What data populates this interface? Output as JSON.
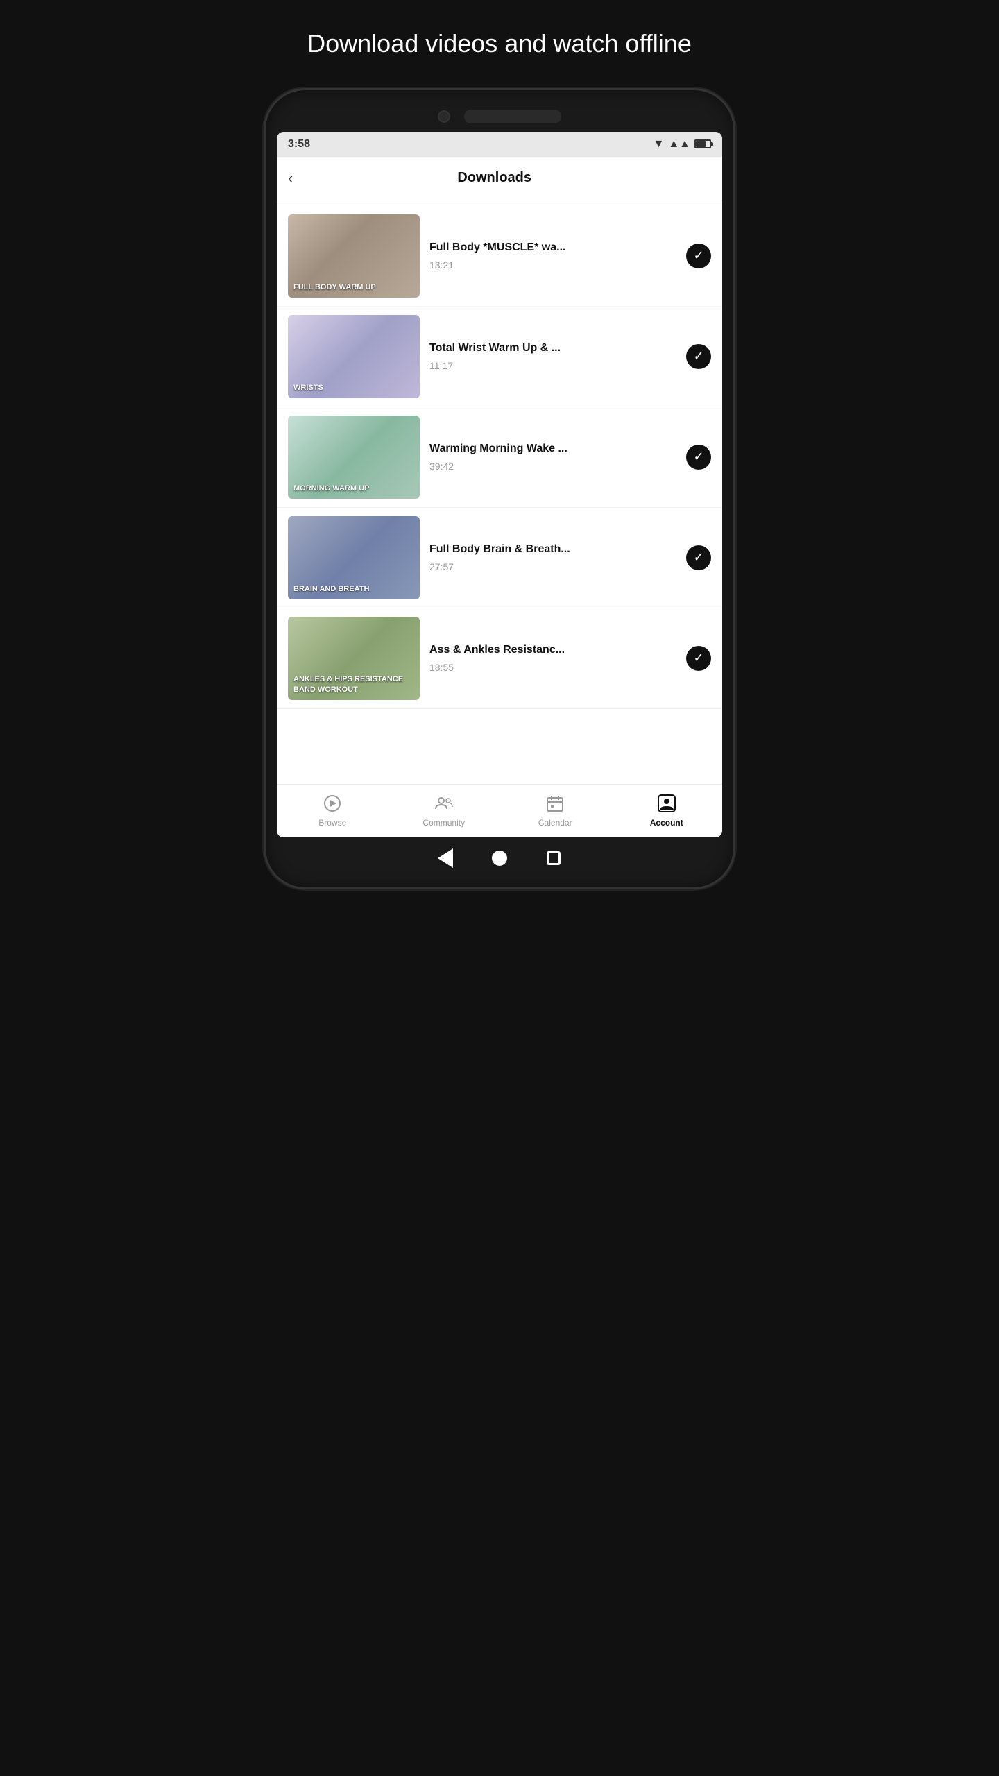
{
  "page": {
    "hero_title": "Download videos and watch offline",
    "screen_title": "Downloads"
  },
  "status_bar": {
    "time": "3:58",
    "wifi": "▼",
    "signal": "▲",
    "battery": "70"
  },
  "videos": [
    {
      "id": 1,
      "title": "Full Body *MUSCLE* wa...",
      "duration": "13:21",
      "thumb_label": "FULL BODY WARM UP",
      "thumb_class": "thumb-1",
      "downloaded": true
    },
    {
      "id": 2,
      "title": "Total Wrist Warm Up & ...",
      "duration": "11:17",
      "thumb_label": "WRISTS",
      "thumb_class": "thumb-2",
      "downloaded": true
    },
    {
      "id": 3,
      "title": "Warming Morning Wake ...",
      "duration": "39:42",
      "thumb_label": "MORNING WARM UP",
      "thumb_class": "thumb-3",
      "downloaded": true
    },
    {
      "id": 4,
      "title": "Full Body Brain & Breath...",
      "duration": "27:57",
      "thumb_label": "BRAIN AND BREATH",
      "thumb_class": "thumb-4",
      "downloaded": true
    },
    {
      "id": 5,
      "title": "Ass & Ankles Resistanc...",
      "duration": "18:55",
      "thumb_label": "ANKLES & HIPS RESISTANCE BAND WORKOUT",
      "thumb_class": "thumb-5",
      "downloaded": true
    }
  ],
  "nav": {
    "items": [
      {
        "id": "browse",
        "label": "Browse",
        "active": false
      },
      {
        "id": "community",
        "label": "Community",
        "active": false
      },
      {
        "id": "calendar",
        "label": "Calendar",
        "active": false
      },
      {
        "id": "account",
        "label": "Account",
        "active": true
      }
    ]
  }
}
